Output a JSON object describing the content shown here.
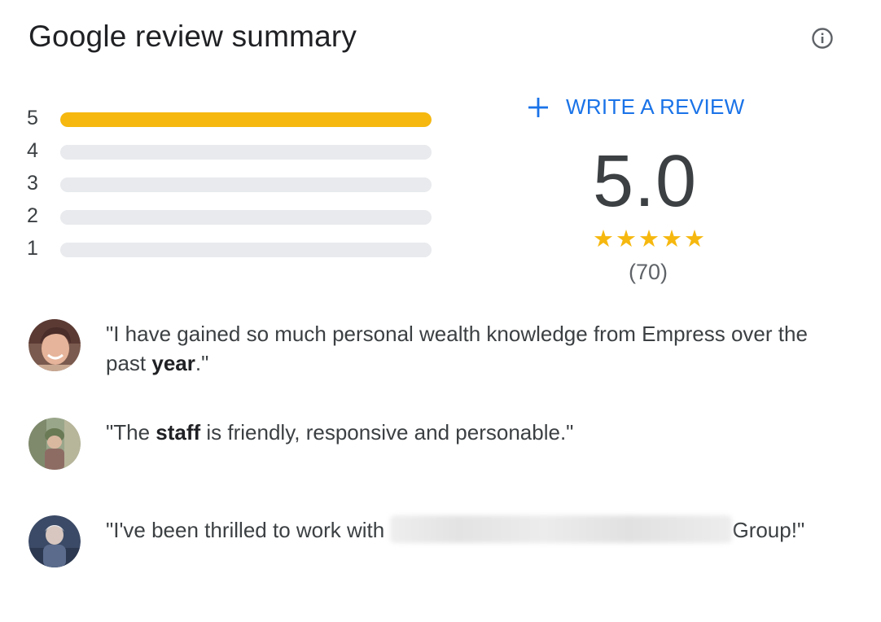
{
  "header": {
    "title": "Google review summary",
    "info_icon": "info-icon"
  },
  "rating_bars": [
    {
      "stars": "5",
      "fraction": 1.0
    },
    {
      "stars": "4",
      "fraction": 0.0
    },
    {
      "stars": "3",
      "fraction": 0.0
    },
    {
      "stars": "2",
      "fraction": 0.0
    },
    {
      "stars": "1",
      "fraction": 0.0
    }
  ],
  "summary": {
    "write_review_label": "WRITE A REVIEW",
    "write_review_icon": "plus-icon",
    "score": "5.0",
    "stars_filled": 5,
    "stars_total": 5,
    "review_count": "(70)"
  },
  "reviews": [
    {
      "before": "\"I have gained so much personal wealth knowledge from Empress over the past ",
      "bold": "year",
      "after": ".\""
    },
    {
      "before": "\"The ",
      "bold": "staff",
      "after": " is friendly, responsive and personable.\""
    },
    {
      "before": "\"I've been thrilled to work with ",
      "after": "Group!\""
    }
  ],
  "colors": {
    "accent_blue": "#1a73e8",
    "star_yellow": "#f6b80f",
    "track_gray": "#e8eaed"
  }
}
